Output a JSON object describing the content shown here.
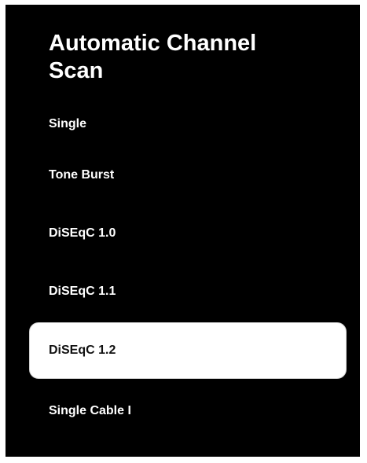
{
  "screen": {
    "title": "Automatic Channel Scan"
  },
  "menu": {
    "items": [
      {
        "label": "Single",
        "selected": false
      },
      {
        "label": "Tone Burst",
        "selected": false
      },
      {
        "label": "DiSEqC 1.0",
        "selected": false
      },
      {
        "label": "DiSEqC 1.1",
        "selected": false
      },
      {
        "label": "DiSEqC 1.2",
        "selected": true
      },
      {
        "label": "Single Cable I",
        "selected": false
      }
    ]
  },
  "colors": {
    "background": "#000000",
    "text": "#ffffff",
    "selected_background": "#ffffff",
    "selected_text": "#111111"
  }
}
